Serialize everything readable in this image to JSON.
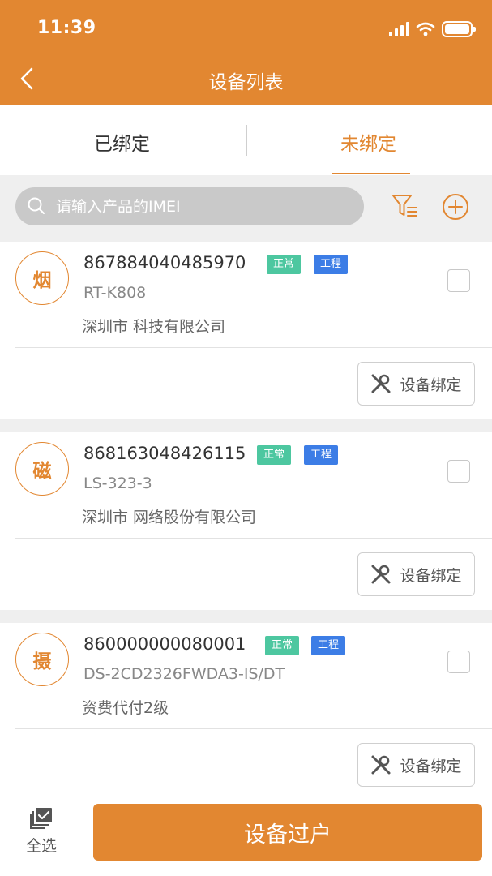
{
  "status_bar": {
    "time": "11:39"
  },
  "header": {
    "title": "设备列表",
    "back_icon": "chevron-left-icon"
  },
  "tabs": [
    {
      "label": "已绑定",
      "active": false
    },
    {
      "label": "未绑定",
      "active": true
    }
  ],
  "search": {
    "placeholder": "请输入产品的IMEI",
    "value": ""
  },
  "toolbar_icons": [
    "filter-icon",
    "plus-circle-icon"
  ],
  "colors": {
    "primary": "#e28731",
    "badge_normal": "#4dc7a0",
    "badge_engineering": "#3c7de6"
  },
  "devices": [
    {
      "avatar": "烟",
      "imei": "867884040485970",
      "status": "正常",
      "type": "工程",
      "model": "RT-K808",
      "company": "深圳市 科技有限公司",
      "bind_label": "设备绑定",
      "checked": false
    },
    {
      "avatar": "磁",
      "imei": "868163048426115",
      "status": "正常",
      "type": "工程",
      "model": "LS-323-3",
      "company": "深圳市 网络股份有限公司",
      "bind_label": "设备绑定",
      "checked": false
    },
    {
      "avatar": "摄",
      "imei": "860000000080001",
      "status": "正常",
      "type": "工程",
      "model": "DS-2CD2326FWDA3-IS/DT",
      "company": "资费代付2级",
      "bind_label": "设备绑定",
      "checked": false
    }
  ],
  "footer": {
    "select_all_label": "全选",
    "transfer_label": "设备过户"
  }
}
